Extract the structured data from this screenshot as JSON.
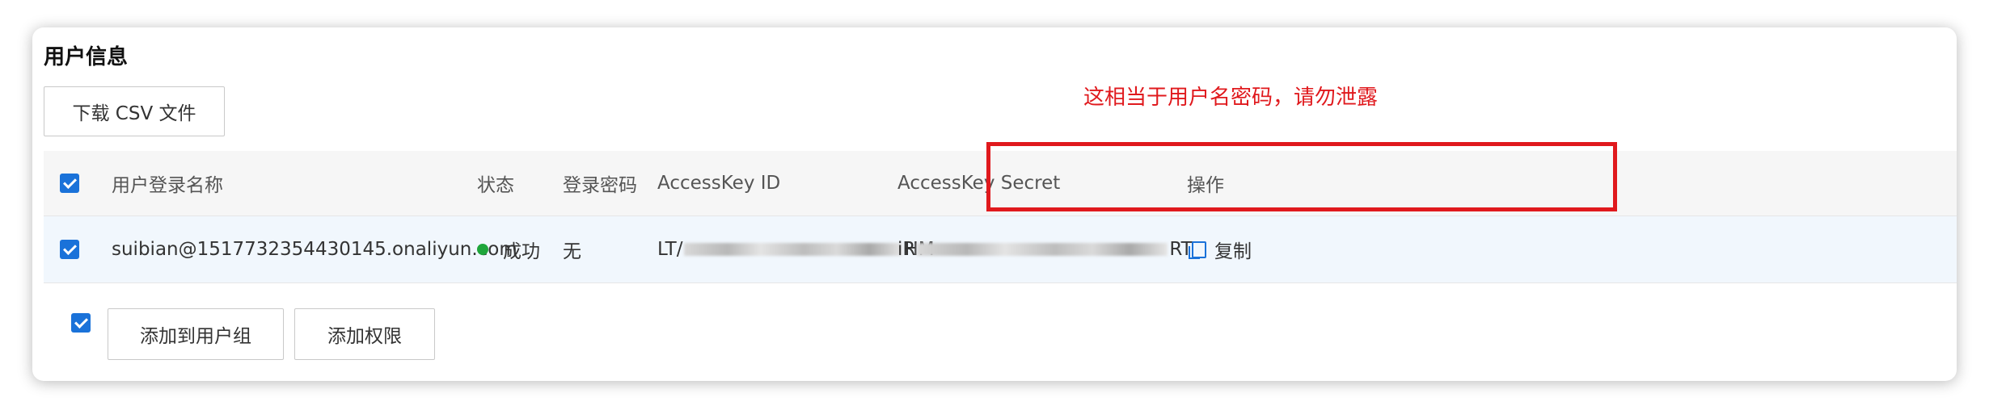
{
  "panel": {
    "title": "用户信息",
    "download_button": "下载 CSV 文件",
    "warning_annotation": "这相当于用户名密码，请勿泄露"
  },
  "table": {
    "columns": [
      "用户登录名称",
      "状态",
      "登录密码",
      "AccessKey ID",
      "AccessKey Secret",
      "操作"
    ],
    "rows": [
      {
        "checked": true,
        "login_name": "suibian@1517732354430145.onaliyun.com",
        "status": "成功",
        "password": "无",
        "accesskey_id_prefix": "LT/",
        "accesskey_id_suffix": "HM",
        "accesskey_secret_prefix": "iR",
        "accesskey_secret_suffix": "RT",
        "action": "复制"
      }
    ]
  },
  "footer": {
    "add_to_group_button": "添加到用户组",
    "add_permission_button": "添加权限"
  },
  "colors": {
    "primary": "#1a72d9",
    "success": "#1fa63b",
    "warning": "#e0191d"
  },
  "icons": {
    "checkbox": "checkbox-checked-icon",
    "status": "status-dot-icon",
    "copy": "copy-icon"
  }
}
